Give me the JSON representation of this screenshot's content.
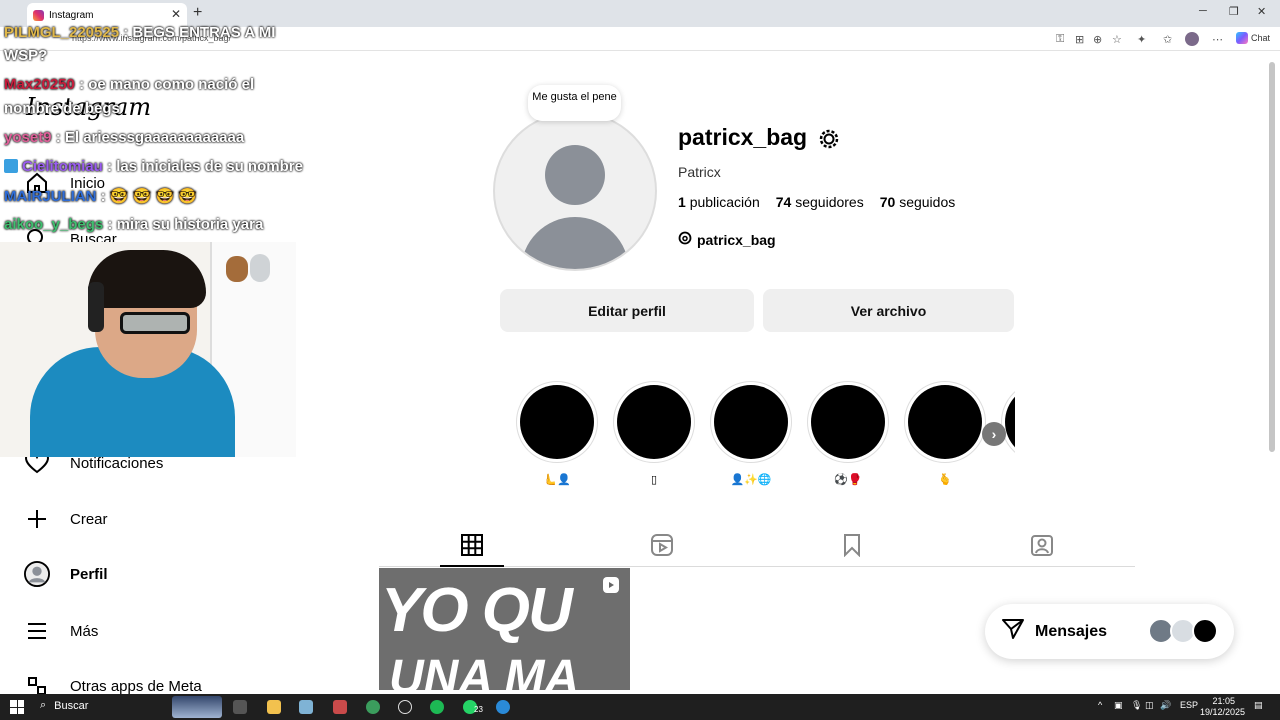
{
  "browser": {
    "tab_title": "Instagram",
    "url": "https://www.instagram.com/patricx_bag/",
    "chat_label": "Chat"
  },
  "sidebar": {
    "logo": "Instagram",
    "items": [
      {
        "label": "Inicio",
        "icon": "home-icon"
      },
      {
        "label": "Buscar",
        "icon": "search-icon"
      },
      {
        "label": "Notificaciones",
        "icon": "heart-icon"
      },
      {
        "label": "Crear",
        "icon": "plus-icon"
      },
      {
        "label": "Perfil",
        "icon": "avatar-icon"
      },
      {
        "label": "Más",
        "icon": "menu-icon"
      },
      {
        "label": "Otras apps de Meta",
        "icon": "meta-apps-icon"
      }
    ]
  },
  "profile": {
    "note": "Me gusta el pene",
    "username": "patricx_bag",
    "full_name": "Patricx",
    "stats": [
      {
        "count": "1",
        "label": "publicación"
      },
      {
        "count": "74",
        "label": "seguidores"
      },
      {
        "count": "70",
        "label": "seguidos"
      }
    ],
    "threads_handle": "patricx_bag",
    "edit_button": "Editar perfil",
    "archive_button": "Ver archivo"
  },
  "highlights": [
    {
      "label": "🫷👤"
    },
    {
      "label": "▯"
    },
    {
      "label": "👤✨🌐"
    },
    {
      "label": "⚽🥊"
    },
    {
      "label": "🫰"
    }
  ],
  "post": {
    "line1": "YO QU",
    "line2": "UNA MA"
  },
  "messages": {
    "label": "Mensajes"
  },
  "chat": [
    {
      "user": "PILMGL_220525",
      "sep": " : ",
      "msg": "BEGS ENTRAS A MI",
      "user_color": "#e0b84a"
    },
    {
      "user": "",
      "sep": "",
      "msg": "WSP?",
      "user_color": "#ffffff"
    },
    {
      "user": "Max20250",
      "sep": " : ",
      "msg": "oe mano como nació el",
      "user_color": "#c81c3c"
    },
    {
      "user": "",
      "sep": "",
      "msg": "nombre de begs",
      "user_color": "#ffffff"
    },
    {
      "user": "yoset9",
      "sep": " : ",
      "msg": "El ariesssgaaaaaaaaaaaa",
      "user_color": "#e0609a"
    },
    {
      "user": "Cielitomiau",
      "sep": " : ",
      "msg": "las iniciales de su nombre",
      "user_color": "#9a5cf0"
    },
    {
      "user": "MAIRJULIAN",
      "sep": " : ",
      "msg": "🤓 🤓 🤓 🤓",
      "user_color": "#2f6dd8"
    },
    {
      "user": "aikoo_y_begs",
      "sep": " : ",
      "msg": "mira su historia yara",
      "user_color": "#3fbf6f"
    }
  ],
  "taskbar": {
    "search_label": "Buscar",
    "lang": "ESP",
    "time": "21:05",
    "date": "19/12/2025",
    "whatsapp_badge": "23"
  }
}
